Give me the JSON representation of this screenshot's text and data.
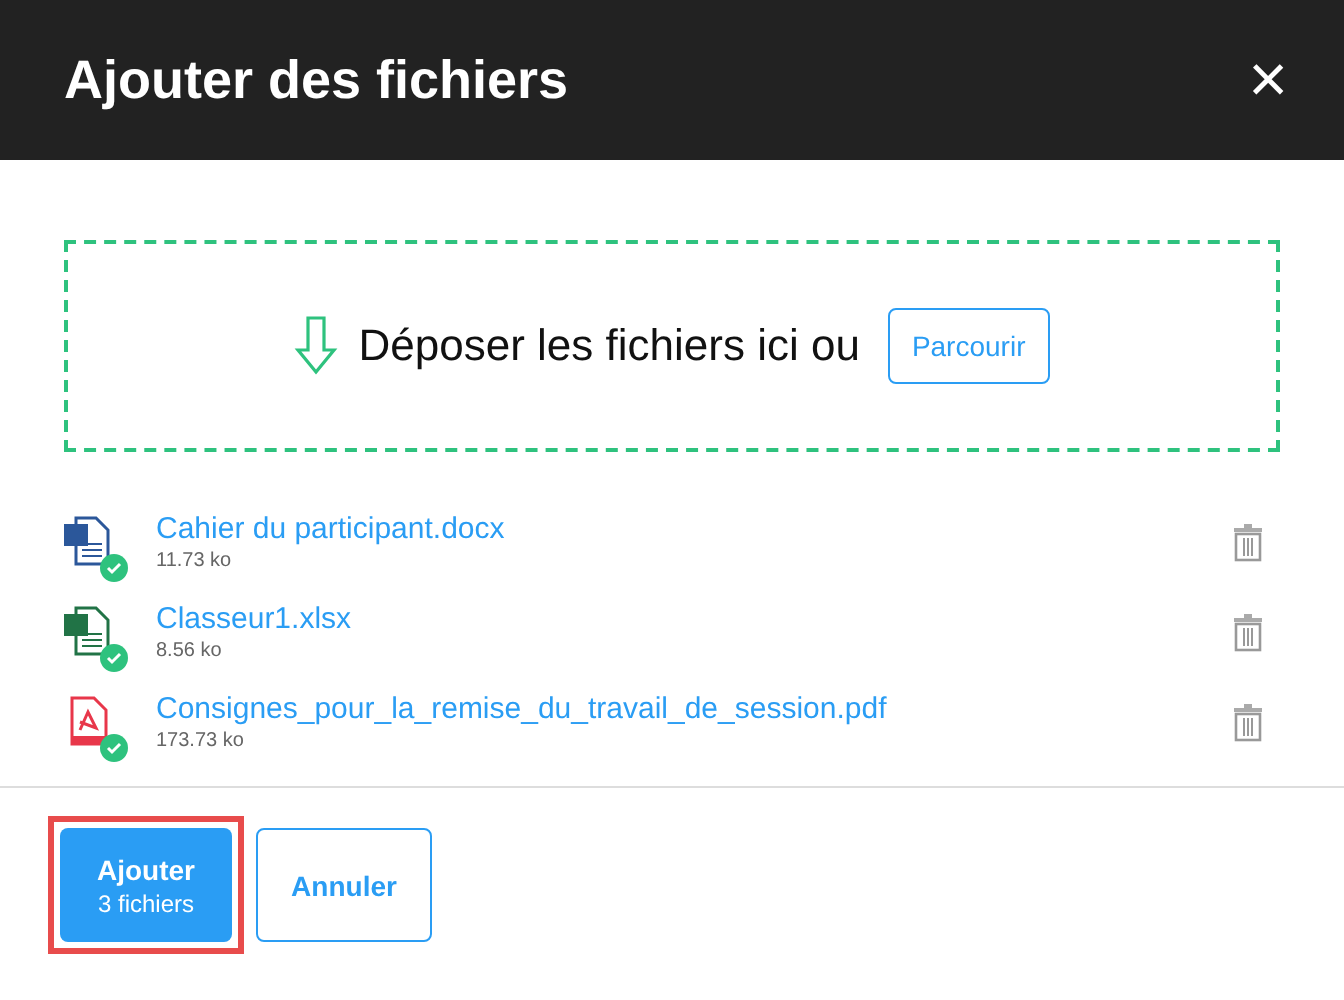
{
  "dialog": {
    "title": "Ajouter des fichiers",
    "close_icon": "×"
  },
  "dropzone": {
    "text": "Déposer les fichiers ici ou",
    "browse_button": "Parcourir"
  },
  "files": [
    {
      "kind": "word",
      "name": "Cahier du participant.docx",
      "size": "11.73 ko",
      "uploaded": true
    },
    {
      "kind": "excel",
      "name": "Classeur1.xlsx",
      "size": "8.56 ko",
      "uploaded": true
    },
    {
      "kind": "pdf",
      "name": "Consignes_pour_la_remise_du_travail_de_session.pdf",
      "size": "173.73 ko",
      "uploaded": true
    }
  ],
  "footer": {
    "add_button": {
      "label": "Ajouter",
      "sublabel": "3 fichiers",
      "highlighted": true
    },
    "cancel_button": "Annuler"
  }
}
